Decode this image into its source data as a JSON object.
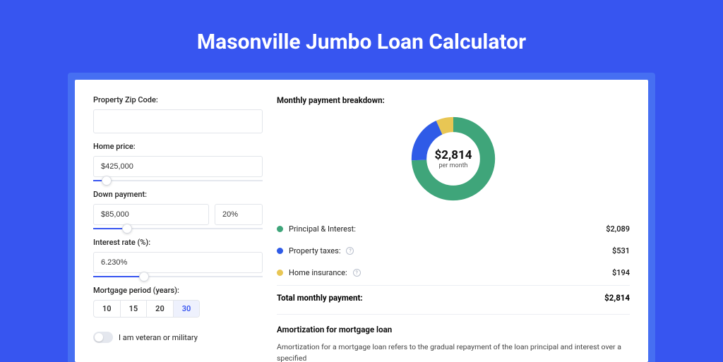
{
  "title": "Masonville Jumbo Loan Calculator",
  "form": {
    "zip_label": "Property Zip Code:",
    "zip_value": "",
    "home_price_label": "Home price:",
    "home_price_value": "$425,000",
    "home_price_slider_pct": 8,
    "down_payment_label": "Down payment:",
    "down_payment_value": "$85,000",
    "down_payment_pct": "20%",
    "down_payment_slider_pct": 20,
    "interest_label": "Interest rate (%):",
    "interest_value": "6.230%",
    "interest_slider_pct": 30,
    "period_label": "Mortgage period (years):",
    "periods": [
      "10",
      "15",
      "20",
      "30"
    ],
    "period_selected": "30",
    "veteran_label": "I am veteran or military"
  },
  "breakdown": {
    "title": "Monthly payment breakdown:",
    "center_value": "$2,814",
    "center_sub": "per month",
    "items": [
      {
        "label": "Principal & Interest:",
        "value": "$2,089",
        "color": "green",
        "info": false
      },
      {
        "label": "Property taxes:",
        "value": "$531",
        "color": "blue",
        "info": true
      },
      {
        "label": "Home insurance:",
        "value": "$194",
        "color": "yellow",
        "info": true
      }
    ],
    "total_label": "Total monthly payment:",
    "total_value": "$2,814"
  },
  "amortization": {
    "title": "Amortization for mortgage loan",
    "text": "Amortization for a mortgage loan refers to the gradual repayment of the loan principal and interest over a specified"
  },
  "chart_data": {
    "type": "pie",
    "title": "Monthly payment breakdown",
    "series": [
      {
        "name": "Principal & Interest",
        "value": 2089,
        "color": "#3fa57a"
      },
      {
        "name": "Property taxes",
        "value": 531,
        "color": "#2f5be7"
      },
      {
        "name": "Home insurance",
        "value": 194,
        "color": "#e8c654"
      }
    ],
    "total": 2814,
    "center_label": "$2,814 per month"
  }
}
